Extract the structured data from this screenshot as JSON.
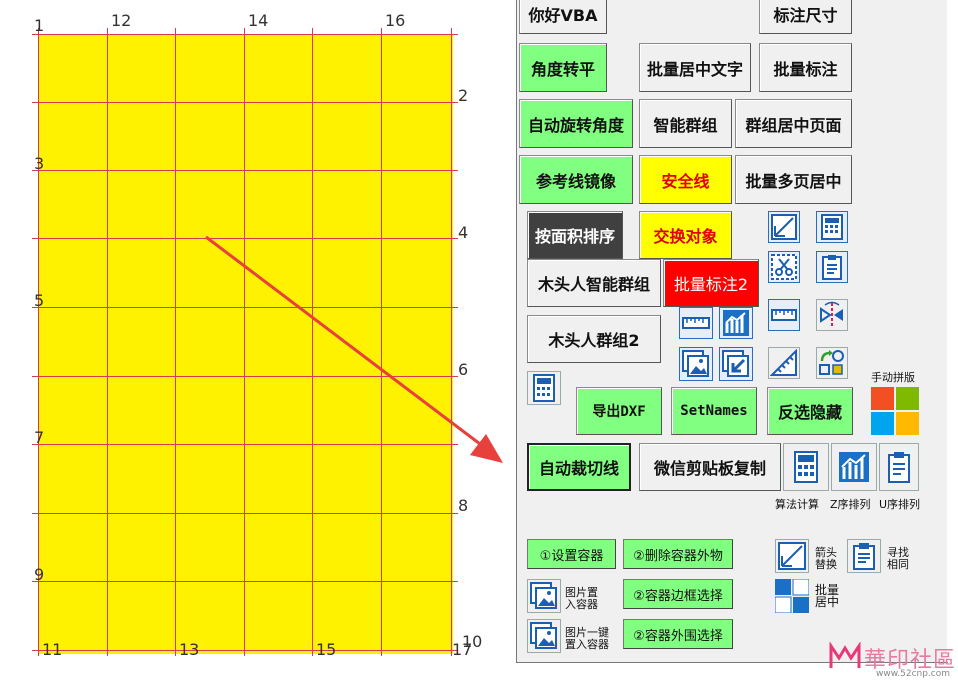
{
  "canvas": {
    "sheet_color": "#fff200",
    "grid_color": "#d83a55",
    "arrow_color": "#e8403c",
    "labels": {
      "n1": "1",
      "n12": "12",
      "n14": "14",
      "n16": "16",
      "n2": "2",
      "n3": "3",
      "n4": "4",
      "n5": "5",
      "n6": "6",
      "n7": "7",
      "n8": "8",
      "n9": "9",
      "n10": "10",
      "n11": "11",
      "n13": "13",
      "n15": "15",
      "n17": "17"
    }
  },
  "panel": {
    "buttons": {
      "hello_vba": "你好VBA",
      "mark_size": "标注尺寸",
      "angle_flat": "角度转平",
      "batch_center_text": "批量居中文字",
      "batch_mark": "批量标注",
      "auto_rotate": "自动旋转角度",
      "smart_group": "智能群组",
      "group_center_page": "群组居中页面",
      "guide_mirror": "参考线镜像",
      "safe_line": "安全线",
      "batch_multipage_center": "批量多页居中",
      "sort_by_area": "按面积排序",
      "swap_objects": "交换对象",
      "wood_smart_group": "木头人智能群组",
      "batch_mark2": "批量标注2",
      "wood_group2": "木头人群组2",
      "export_dxf": "导出DXF",
      "set_names": "SetNames",
      "invert_hide": "反选隐藏",
      "auto_cut_line": "自动裁切线",
      "wechat_clipboard_copy": "微信剪贴板复制"
    },
    "manual_layout_label": "手动拼版",
    "icon_labels": {
      "algo_calc": "算法计算",
      "z_sort": "Z序排列",
      "u_sort": "U序排列"
    },
    "container": {
      "set_container": "①设置容器",
      "delete_outside": "②删除容器外物",
      "image_into_container_l1": "图片置",
      "image_into_container_l2": "入容器",
      "border_select": "②容器边框选择",
      "image_one_click_l1": "图片一键",
      "image_one_click_l2": "置入容器",
      "outer_select": "②容器外围选择",
      "arrow_replace_l1": "箭头",
      "arrow_replace_l2": "替换",
      "find_same_l1": "寻找",
      "find_same_l2": "相同",
      "batch_center_l1": "批量",
      "batch_center_l2": "居中"
    },
    "colors": {
      "green": "#80ff80",
      "yellow": "#ffff00",
      "red": "#ff0000",
      "dark": "#404040"
    }
  },
  "watermark": {
    "text": "華印社區",
    "url": "www.52cnp.com"
  }
}
